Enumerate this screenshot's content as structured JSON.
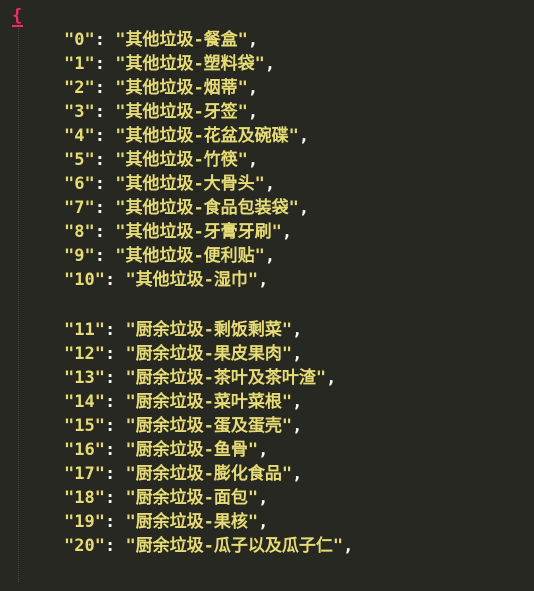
{
  "editor": {
    "open_brace": "{",
    "group1": [
      {
        "key": "\"0\"",
        "value": "\"其他垃圾-餐盒\""
      },
      {
        "key": "\"1\"",
        "value": "\"其他垃圾-塑料袋\""
      },
      {
        "key": "\"2\"",
        "value": "\"其他垃圾-烟蒂\""
      },
      {
        "key": "\"3\"",
        "value": "\"其他垃圾-牙签\""
      },
      {
        "key": "\"4\"",
        "value": "\"其他垃圾-花盆及碗碟\""
      },
      {
        "key": "\"5\"",
        "value": "\"其他垃圾-竹筷\""
      },
      {
        "key": "\"6\"",
        "value": "\"其他垃圾-大骨头\""
      },
      {
        "key": "\"7\"",
        "value": "\"其他垃圾-食品包装袋\""
      },
      {
        "key": "\"8\"",
        "value": "\"其他垃圾-牙膏牙刷\""
      },
      {
        "key": "\"9\"",
        "value": "\"其他垃圾-便利贴\""
      },
      {
        "key": "\"10\"",
        "value": "\"其他垃圾-湿巾\""
      }
    ],
    "group2": [
      {
        "key": "\"11\"",
        "value": "\"厨余垃圾-剩饭剩菜\""
      },
      {
        "key": "\"12\"",
        "value": "\"厨余垃圾-果皮果肉\""
      },
      {
        "key": "\"13\"",
        "value": "\"厨余垃圾-茶叶及茶叶渣\""
      },
      {
        "key": "\"14\"",
        "value": "\"厨余垃圾-菜叶菜根\""
      },
      {
        "key": "\"15\"",
        "value": "\"厨余垃圾-蛋及蛋壳\""
      },
      {
        "key": "\"16\"",
        "value": "\"厨余垃圾-鱼骨\""
      },
      {
        "key": "\"17\"",
        "value": "\"厨余垃圾-膨化食品\""
      },
      {
        "key": "\"18\"",
        "value": "\"厨余垃圾-面包\""
      },
      {
        "key": "\"19\"",
        "value": "\"厨余垃圾-果核\""
      },
      {
        "key": "\"20\"",
        "value": "\"厨余垃圾-瓜子以及瓜子仁\""
      }
    ]
  }
}
